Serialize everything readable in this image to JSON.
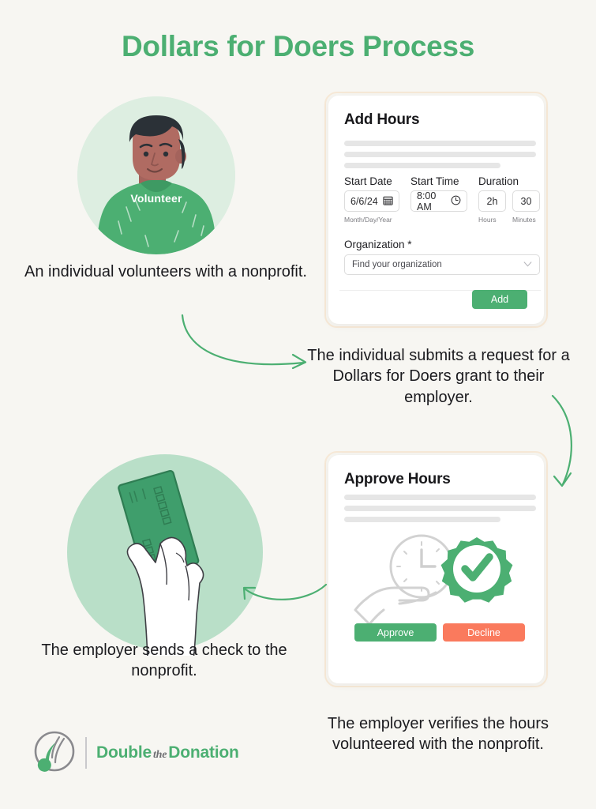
{
  "title": "Dollars for Doers Process",
  "theme": {
    "background": "#f7f6f2",
    "green": "#4caf72",
    "coral": "#fa7a5d",
    "card_border": "#f7e9d7",
    "circle_light": "#ddeee1",
    "circle_mint": "#b9dfc8",
    "text": "#1b1b1f"
  },
  "volunteer": {
    "shirt_label": "Volunteer",
    "alt": "illustration of a smiling volunteer wearing a green t-shirt"
  },
  "money": {
    "alt": "illustration of a hand holding a green banknote"
  },
  "add_hours_card": {
    "title": "Add Hours",
    "start_date": {
      "label": "Start Date",
      "value": "6/6/24",
      "sublabel": "Month/Day/Year",
      "icon": "calendar-icon"
    },
    "start_time": {
      "label": "Start Time",
      "value": "8:00 AM",
      "icon": "clock-icon"
    },
    "duration": {
      "label": "Duration",
      "hours_value": "2h",
      "hours_sublabel": "Hours",
      "minutes_value": "30",
      "minutes_sublabel": "Minutes"
    },
    "organization": {
      "label": "Organization *",
      "placeholder": "Find your organization",
      "icon": "chevron-down-icon"
    },
    "submit_label": "Add"
  },
  "approve_hours_card": {
    "title": "Approve Hours",
    "illustration_alt": "hand holding a clock with a green check-mark badge",
    "approve_label": "Approve",
    "decline_label": "Decline"
  },
  "captions": {
    "step1": "An individual volunteers with a nonprofit.",
    "step2": "The individual submits a request for a Dollars for Doers grant to their employer.",
    "step3": "The employer sends a check to the nonprofit.",
    "step4": "The employer verifies the hours volunteered with the nonprofit."
  },
  "logo": {
    "word1": "Double",
    "word_the": "the",
    "word2": "Donation"
  }
}
